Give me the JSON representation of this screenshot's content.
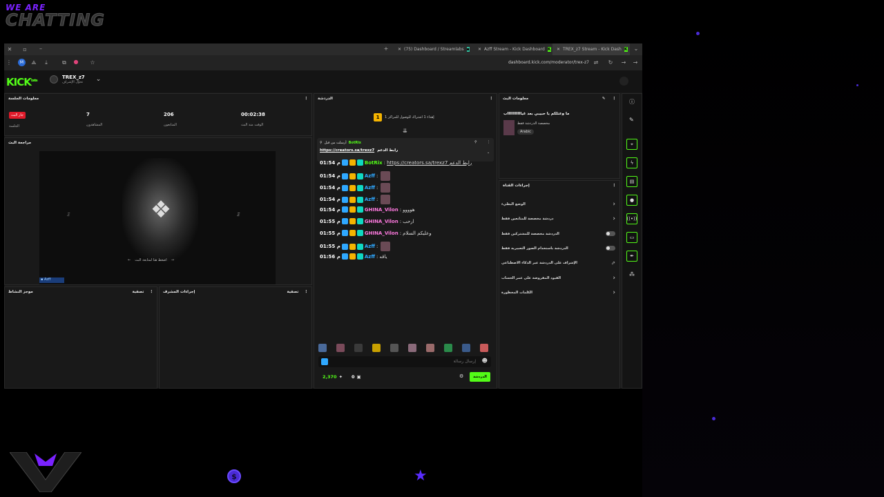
{
  "overlay": {
    "line1": "WE ARE",
    "line2": "CHATTING"
  },
  "tabs": [
    {
      "label": "(75) Dashboard / Streamlabs",
      "active": false
    },
    {
      "label": "Azff Stream - Kick Dashboard",
      "active": false
    },
    {
      "label": "TREX_z7 Stream - Kick Dash",
      "active": true
    }
  ],
  "address": {
    "url": "dashboard.kick.com/moderator/trex-z7"
  },
  "header": {
    "logo": "KICK",
    "logo_sup": "beta",
    "channel_name": "TREX_z7",
    "channel_sub": "تحوّل الإشراف"
  },
  "session": {
    "title": "معلومات الجلسة",
    "live_badge": "جار البث",
    "live_label": "الجلسة",
    "viewers_value": "7",
    "viewers_label": "المشاهدون",
    "followers_value": "206",
    "followers_label": "المتابعون",
    "uptime_value": "00:02:38",
    "uptime_label": "الوقت منذ البث"
  },
  "stream_review": {
    "title": "مراجعة البث",
    "video_caption": "اضغط هنا لمتابعة البث"
  },
  "activity": {
    "title": "موجز النشاط",
    "filter": "تصفية"
  },
  "mod_actions": {
    "title": "إجراءات المشرف",
    "filter": "تصفية"
  },
  "chat": {
    "title": "الدردشة",
    "goal_text": "إهداء 1 اشتراك للوصول للمراكز 1",
    "goal_badge": "1",
    "pinned_by": "أرسلت من قبل",
    "pinned_user": "BotRix",
    "pinned_title": "رابط الدعم",
    "pinned_link": "https://creators.sa/trexz7",
    "messages": [
      {
        "time": "01:54 م",
        "user": "BotRix",
        "color": "#53fc18",
        "text": "https://creators.sa/trexz7 رابط الدعم",
        "link": true
      },
      {
        "time": "01:54 م",
        "user": "Azff",
        "color": "#2fa8ff",
        "text": "",
        "emote": true
      },
      {
        "time": "01:54 م",
        "user": "Azff",
        "color": "#2fa8ff",
        "text": "",
        "emote": true
      },
      {
        "time": "01:54 م",
        "user": "Azff",
        "color": "#2fa8ff",
        "text": "",
        "emote": true
      },
      {
        "time": "01:54 م",
        "user": "GHINA_Vilon",
        "color": "#ff7ae0",
        "text": "هوووو",
        "emote": false
      },
      {
        "time": "01:55 م",
        "user": "GHINA_Vilon",
        "color": "#ff7ae0",
        "text": "ارحب",
        "emote": false
      },
      {
        "time": "01:55 م",
        "user": "GHINA_Vilon",
        "color": "#ff7ae0",
        "text": "وعليكم السلام",
        "emote": false
      },
      {
        "time": "01:55 م",
        "user": "Azff",
        "color": "#2fa8ff",
        "text": "",
        "emote": true
      },
      {
        "time": "01:56 م",
        "user": "Azff",
        "color": "#2fa8ff",
        "text": "ياقه",
        "emote": false
      }
    ],
    "input_placeholder": "إرسال رسالة",
    "points": "2,370",
    "count": "0",
    "send_label": "الدردشة"
  },
  "stream_info": {
    "title": "معلومات البث",
    "stream_title": "ما وعتلكم يا حبيبي بعد غياااااااااااب",
    "category": "مخصصة الدردشة فقط",
    "tag": "Arabic"
  },
  "channel_actions": {
    "title": "إجراءات القناة",
    "items": [
      {
        "label": "الوضع البطيء",
        "control": "chevron"
      },
      {
        "label": "دردشة مخصصة للمتابعين فقط",
        "control": "chevron"
      },
      {
        "label": "الدردشة مخصصة للمشتركين فقط",
        "control": "toggle"
      },
      {
        "label": "الدردشة باستخدام الصور التعبيرية فقط",
        "control": "toggle"
      },
      {
        "label": "الإشراف على الدردشة عبر الذكاء الاصطناعي",
        "control": "external"
      },
      {
        "label": "القيود المفروضة على عمر الحساب",
        "control": "chevron"
      },
      {
        "label": "الكلمات المحظورة",
        "control": "chevron"
      }
    ]
  }
}
